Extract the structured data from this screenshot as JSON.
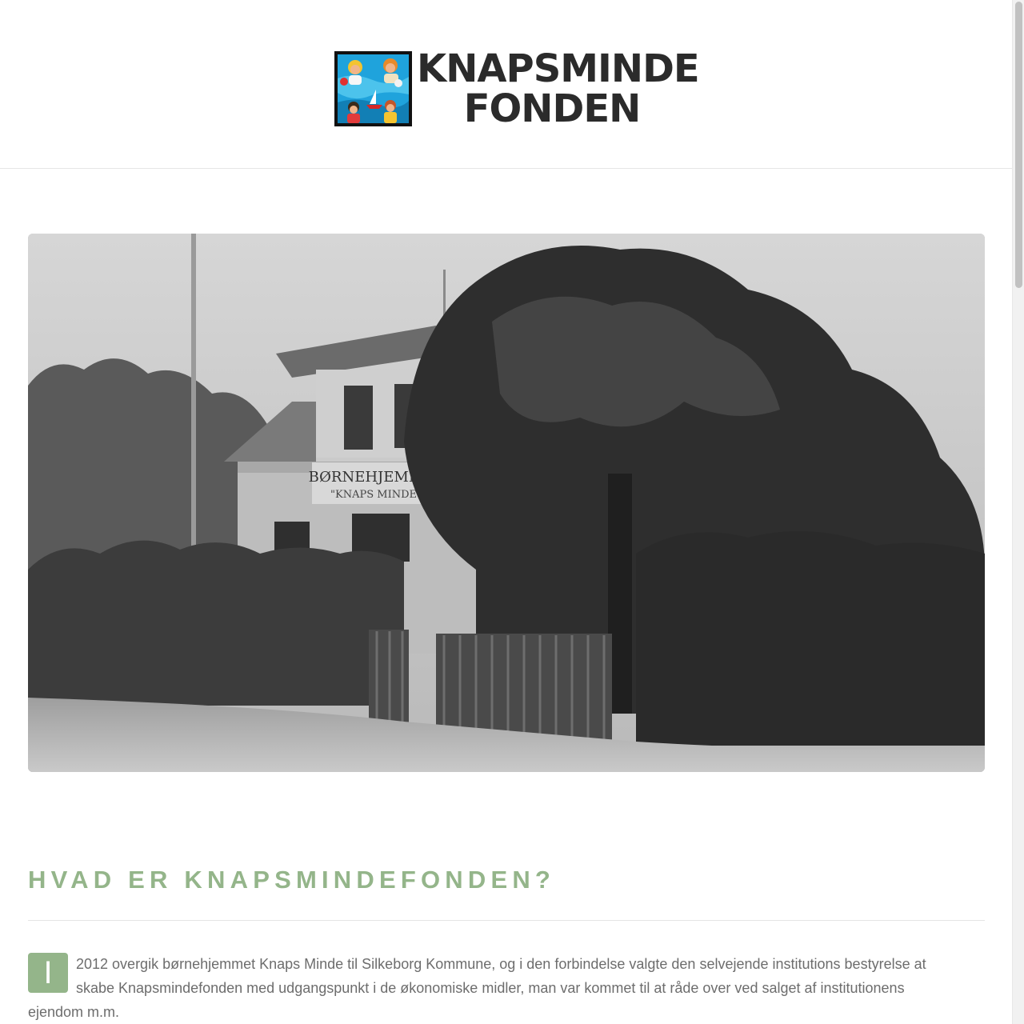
{
  "header": {
    "logo_line1": "KNAPSMINDE",
    "logo_line2": "FONDEN",
    "logo_image": "logo-painting-children-swimming"
  },
  "hero": {
    "image": "historic-photo-children-home-building",
    "sign_line1": "BØRNEHJEMMET",
    "sign_line2": "\"KNAPS MINDE\""
  },
  "content": {
    "title": "HVAD ER KNAPSMINDEFONDEN?",
    "dropcap": "I",
    "paragraph": "2012 overgik børnehjemmet Knaps Minde til Silkeborg Kommune, og i den forbindelse valgte den selvejende institutions bestyrelse at skabe Knapsmindefonden med udgangspunkt i de økonomiske midler, man var kommet til at råde over ved salget af institutionens ejendom m.m."
  },
  "colors": {
    "accent": "#94b58a",
    "text": "#6d6d6d",
    "heading_dark": "#2b2b2b"
  }
}
